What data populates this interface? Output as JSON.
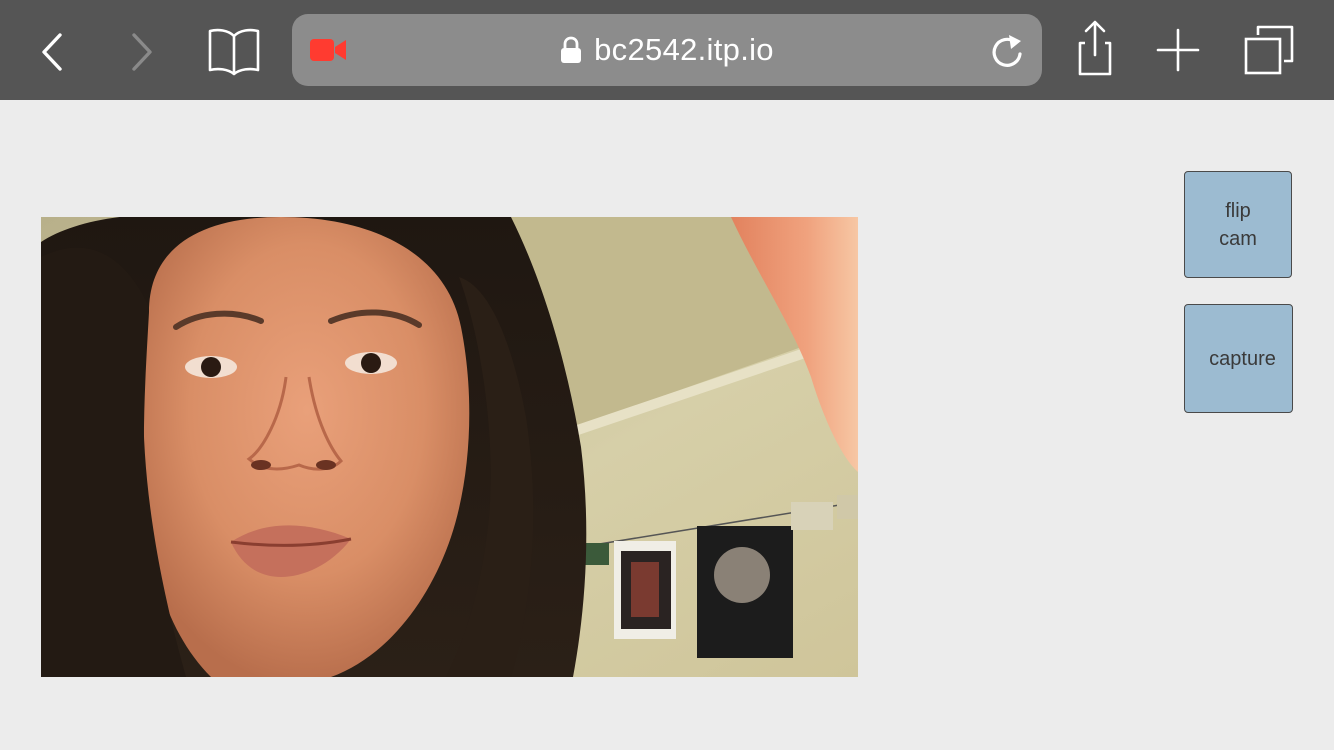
{
  "browser": {
    "url": "bc2542.itp.io",
    "back_icon": "chevron-left-icon",
    "forward_icon": "chevron-right-icon",
    "bookmarks_icon": "book-icon",
    "recording_icon": "camera-recording-icon",
    "lock_icon": "lock-icon",
    "reload_icon": "reload-icon",
    "share_icon": "share-icon",
    "new_tab_icon": "plus-icon",
    "tabs_icon": "tabs-icon",
    "colors": {
      "toolbar": "#555555",
      "addressbar": "#8c8c8c",
      "recording": "#ff3b30"
    }
  },
  "page": {
    "video_feed": "camera-preview",
    "buttons": {
      "flip_cam_label": "flip\ncam",
      "capture_label": "capture"
    },
    "colors": {
      "background": "#ececec",
      "button": "#9cbbd1"
    }
  }
}
